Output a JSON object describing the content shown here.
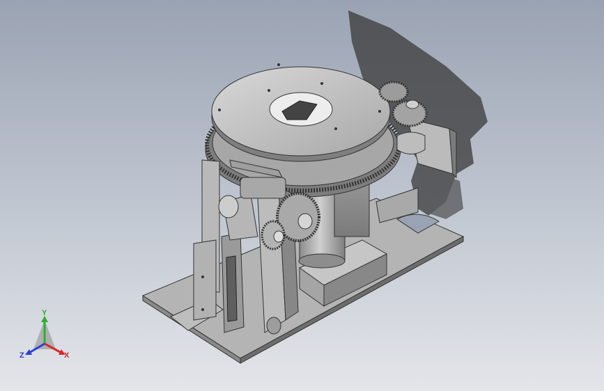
{
  "viewport": {
    "background_top": "#9aa3b3",
    "background_bottom": "#e3e5e9",
    "model_color": "#b9b9b9",
    "shadow_color": "#3a3a3a"
  },
  "triad": {
    "x_label": "X",
    "y_label": "Y",
    "z_label": "Z",
    "x_color": "#d62a2a",
    "y_color": "#2fae2f",
    "z_color": "#2b3fd6"
  }
}
